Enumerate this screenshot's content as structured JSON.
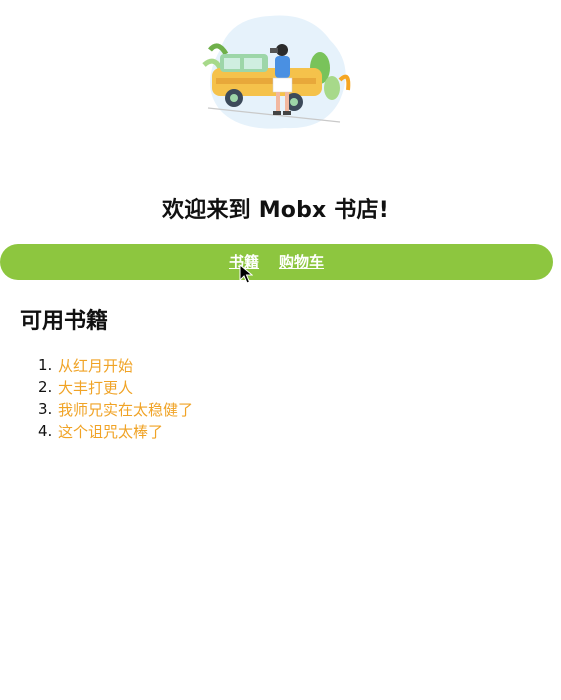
{
  "header": {
    "title": "欢迎来到 Mobx 书店!"
  },
  "nav": {
    "items": [
      {
        "label": "书籍"
      },
      {
        "label": "购物车"
      }
    ]
  },
  "books": {
    "heading": "可用书籍",
    "items": [
      {
        "number": "1.",
        "title": "从红月开始"
      },
      {
        "number": "2.",
        "title": "大丰打更人"
      },
      {
        "number": "3.",
        "title": "我师兄实在太稳健了"
      },
      {
        "number": "4.",
        "title": "这个诅咒太棒了"
      }
    ]
  },
  "colors": {
    "nav_bg": "#8dc63f",
    "link": "#f0a326"
  },
  "icons": {
    "hero": "travel-illustration",
    "cursor": "pointer-cursor"
  }
}
